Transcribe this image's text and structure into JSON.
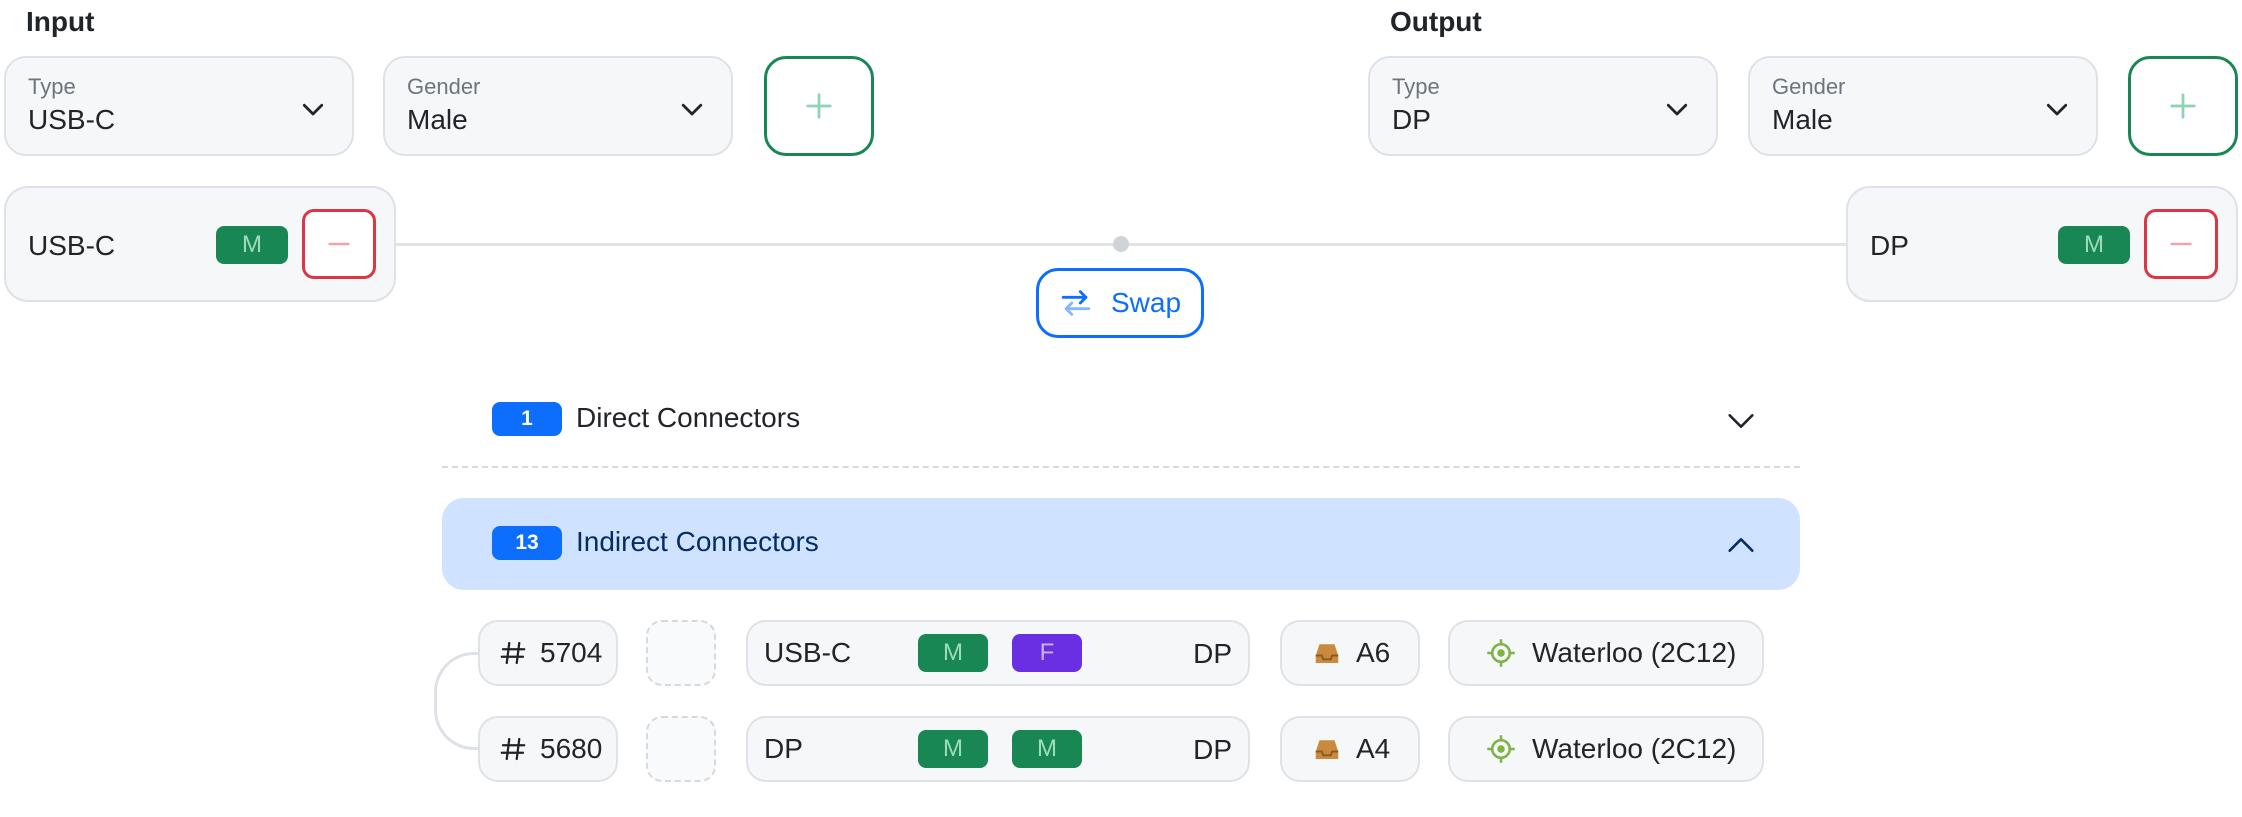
{
  "input": {
    "title": "Input",
    "type_label": "Type",
    "type_value": "USB-C",
    "gender_label": "Gender",
    "gender_value": "Male",
    "port_name": "USB-C",
    "port_gender": "M"
  },
  "output": {
    "title": "Output",
    "type_label": "Type",
    "type_value": "DP",
    "gender_label": "Gender",
    "gender_value": "Male",
    "port_name": "DP",
    "port_gender": "M"
  },
  "swap_label": "Swap",
  "direct": {
    "count": "1",
    "title": "Direct Connectors"
  },
  "indirect": {
    "count": "13",
    "title": "Indirect Connectors"
  },
  "rows": [
    {
      "id": "5704",
      "from": "USB-C",
      "g1": "M",
      "g2": "F",
      "to": "DP",
      "bin": "A6",
      "location": "Waterloo (2C12)"
    },
    {
      "id": "5680",
      "from": "DP",
      "g1": "M",
      "g2": "M",
      "to": "DP",
      "bin": "A4",
      "location": "Waterloo (2C12)"
    }
  ],
  "colors": {
    "accent": "#0d6efd",
    "male": "#198754",
    "female": "#6b2fe3",
    "danger": "#dc3545"
  },
  "icons": {
    "add": "plus-icon",
    "remove": "minus-icon",
    "swap": "swap-arrows-icon",
    "id": "hash-icon",
    "bin": "tray-icon",
    "location": "location-target-icon"
  }
}
